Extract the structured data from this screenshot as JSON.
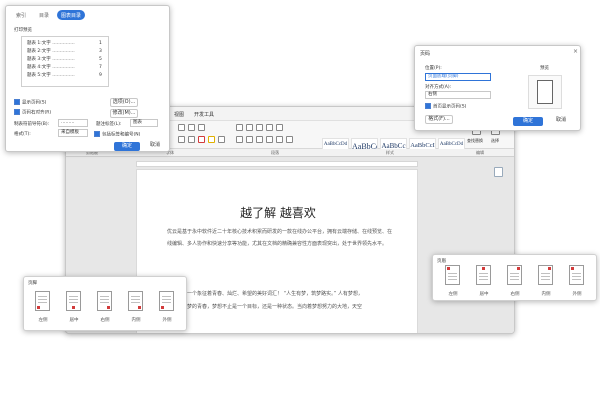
{
  "toc_dialog": {
    "tabs": [
      "索引",
      "目录",
      "图表目录"
    ],
    "print_preview_label": "打印预览",
    "toc_lines": [
      {
        "text": "题表 1:文字 ……………",
        "page": "1"
      },
      {
        "text": "题表 2:文字 ……………",
        "page": "3"
      },
      {
        "text": "题表 3:文字 ……………",
        "page": "5"
      },
      {
        "text": "题表 4:文字 ……………",
        "page": "7"
      },
      {
        "text": "题表 5:文字 ……………",
        "page": "9"
      }
    ],
    "show_page_numbers": "显示页码(S)",
    "right_align": "页码右对齐(R)",
    "tab_leader_label": "制表符前导符(B):",
    "tab_leader_value": "………",
    "format_label": "格式(T):",
    "format_value": "来自模板",
    "options_button": "选项(O)...",
    "modify_button": "修改(M)...",
    "caption_label": "题注标签(L):",
    "caption_value": "图表",
    "include_label": "包括标签和编号(N)",
    "ok": "确定",
    "cancel": "取消"
  },
  "page_number_dialog": {
    "title": "页码",
    "position_label": "位置(P):",
    "position_value": "页面底端(页脚)",
    "alignment_label": "对齐方式(A):",
    "alignment_value": "右侧",
    "first_page": "首页显示页码(S)",
    "format_button": "格式(F)...",
    "preview_label": "预览",
    "ok": "确定",
    "cancel": "取消",
    "close": "×"
  },
  "main_window": {
    "menu_items": [
      "视图",
      "开发工具"
    ],
    "styles": [
      {
        "preview": "AaBbCcDd",
        "name": "正文"
      },
      {
        "preview": "AaBbCc",
        "name": "标题 1"
      },
      {
        "preview": "AaBbCc",
        "name": "标题 2"
      },
      {
        "preview": "AaBbCcI",
        "name": "标题 3"
      },
      {
        "preview": "AaBbCcDd",
        "name": "标题"
      }
    ],
    "group_labels": [
      "剪贴板",
      "字体",
      "段落",
      "样式",
      "编辑"
    ],
    "right_tools": [
      "查找替换",
      "选择"
    ],
    "doc_title": "越了解 越喜欢",
    "doc_para1": "优云是基于永中软件近二十年核心技术积累而研发的一款在线办公平台，拥有云端存储、在线预览、在线编辑、多人协作和快速分享等功能，尤其在文档的精确兼容性方面表现突出，处于世界领先水平。",
    "doc_para2_partial": "一个象征着青春、灿烂、希望的美好词汇！ “人生有梦，筑梦路实。” 人有梦想，",
    "doc_para3_partial": "梦的青春，梦想不止是一个目标，还是一种状态。当向着梦想努力的大地，天空"
  },
  "footer_popup": {
    "title": "页脚",
    "options": [
      "左侧",
      "居中",
      "右侧",
      "内侧",
      "外侧"
    ]
  },
  "header_popup": {
    "title": "页眉",
    "options": [
      "左侧",
      "居中",
      "右侧",
      "内侧",
      "外侧"
    ]
  },
  "colors": {
    "accent": "#2f74d8",
    "mark": "#d23b3b"
  }
}
